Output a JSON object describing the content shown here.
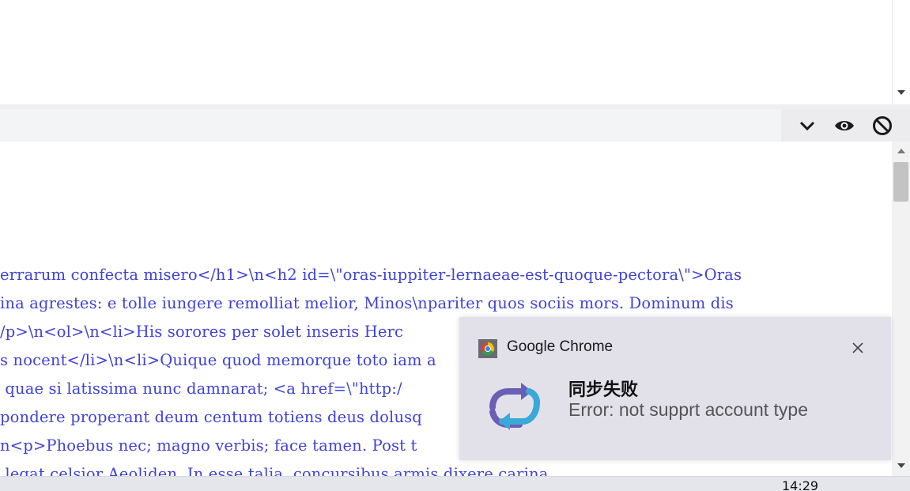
{
  "toolbar": {
    "icons": [
      "chevron-down-icon",
      "eye-icon",
      "prohibit-icon"
    ]
  },
  "code_lines": [
    "errarum confecta misero</h1>\\n<h2 id=\\\"oras-iuppiter-lernaeae-est-quoque-pectora\\\">Oras",
    "ina agrestes: e tolle iungere remolliat melior, Minos\\npariter quos sociis mors. Dominum dis",
    "/p>\\n<ol>\\n<li>His sorores per solet inseris Herc",
    "s nocent</li>\\n<li>Quique quod memorque toto iam a",
    " quae si latissima nunc damnarat; <a href=\\\"http:/",
    "pondere properant deum centum totiens deus dolusq",
    "n<p>Phoebus nec; magno verbis; face tamen. Post t",
    " legat celsior Aeoliden. In esse talia, concursibus armis dixere carina"
  ],
  "taskbar": {
    "clock": "14:29"
  },
  "notification": {
    "app_name": "Google Chrome",
    "title": "同步失败",
    "message": "Error: not supprt account type",
    "app_icon": "chrome-icon",
    "main_icon": "sync-icon",
    "colors": {
      "sync_purple": "#6a5fb5",
      "sync_blue": "#3aa8d8",
      "background": "#e2e1ea"
    }
  },
  "colors": {
    "code_text": "#3f43d9"
  }
}
